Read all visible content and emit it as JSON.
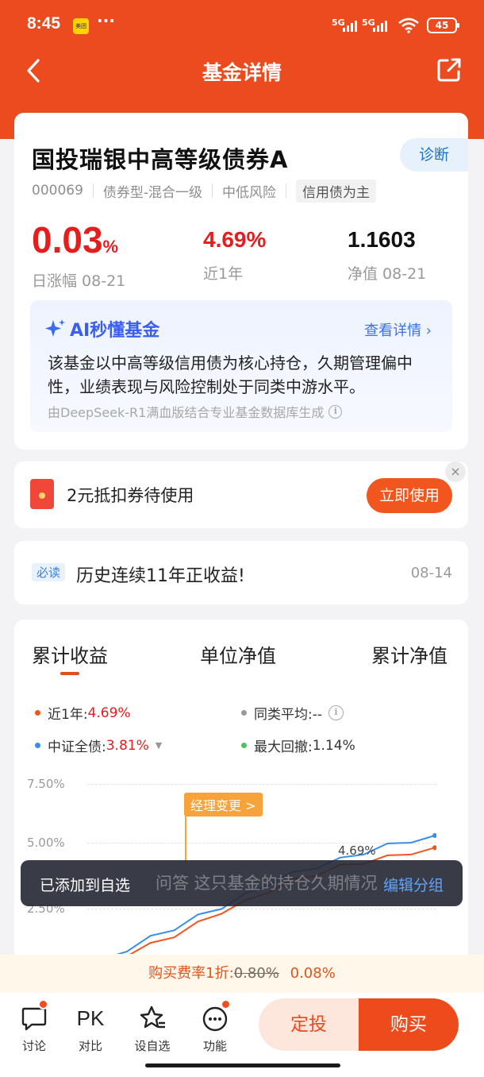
{
  "status": {
    "time": "8:45",
    "app_badge": "美团",
    "dots": "···",
    "sig1": "5G",
    "sig2": "5G",
    "battery": "45"
  },
  "nav": {
    "title": "基金详情"
  },
  "fund": {
    "name": "国投瑞银中高等级债券A",
    "diagnose": "诊断",
    "code": "000069",
    "type": "债券型-混合一级",
    "risk": "中低风险",
    "focus": "信用债为主",
    "daily_value": "0.03",
    "daily_unit": "%",
    "daily_label": "日涨幅 08-21",
    "year_value": "4.69%",
    "year_label": "近1年",
    "nav_value": "1.1603",
    "nav_label": "净值 08-21"
  },
  "ai": {
    "title": "AI秒懂基金",
    "link": "查看详情 ›",
    "text": "该基金以中高等级信用债为核心持仓，久期管理偏中性，业绩表现与风险控制处于同类中游水平。",
    "source": "由DeepSeek-R1满血版结合专业基金数据库生成"
  },
  "coupon": {
    "text": "2元抵扣券待使用",
    "button": "立即使用",
    "close": "×"
  },
  "news": {
    "tag": "必读",
    "text": "历史连续11年正收益!",
    "date": "08-14"
  },
  "chart": {
    "tabs": [
      "累计收益",
      "单位净值",
      "累计净值"
    ],
    "legend": {
      "year_label": "近1年:",
      "year_value": "4.69%",
      "peer_label": "同类平均:--",
      "index_label": "中证全债:",
      "index_value": "3.81%",
      "drawdown_label": "最大回撤:",
      "drawdown_value": "1.14%"
    },
    "y_ticks": [
      "7.50%",
      "5.00%",
      "2.50%"
    ],
    "manager_change": "经理变更 >",
    "end_label": "4.69%",
    "colors": {
      "fund": "#f0561e",
      "index": "#3b8de8",
      "peer": "#999999",
      "drawdown": "#4cc35e"
    }
  },
  "chart_data": {
    "type": "line",
    "title": "",
    "ylim": [
      0,
      7.5
    ],
    "series": [
      {
        "name": "近1年",
        "values": [
          0.0,
          0.2,
          0.6,
          1.0,
          1.5,
          2.0,
          2.4,
          2.9,
          3.3,
          3.6,
          3.9,
          4.1,
          4.3,
          4.5,
          4.69
        ]
      },
      {
        "name": "中证全债",
        "values": [
          0.0,
          0.4,
          0.9,
          1.3,
          1.8,
          2.2,
          2.7,
          3.2,
          3.6,
          3.9,
          4.2,
          4.5,
          4.8,
          5.0,
          5.2
        ]
      }
    ]
  },
  "toast": {
    "message": "已添加到自选",
    "ghost": "问答 这只基金的持仓久期情况",
    "action": "编辑分组"
  },
  "fee": {
    "prefix": "购买费率1折:",
    "old": "0.80%",
    "new": "0.08%"
  },
  "bottom": {
    "discuss": "讨论",
    "pk_icon": "PK",
    "pk": "对比",
    "watch": "设自选",
    "func": "功能",
    "fixed": "定投",
    "buy": "购买"
  }
}
